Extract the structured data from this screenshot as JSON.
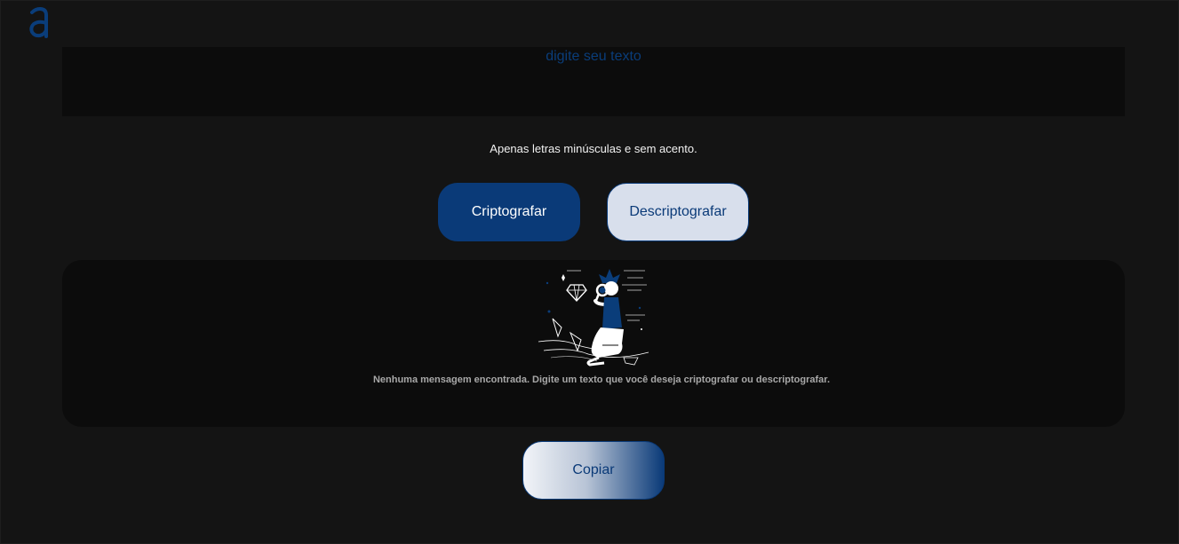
{
  "input": {
    "placeholder": "digite seu texto"
  },
  "hint": "Apenas letras minúsculas e sem acento.",
  "buttons": {
    "encrypt": "Criptografar",
    "decrypt": "Descriptografar",
    "copy": "Copiar"
  },
  "output": {
    "empty_message": "Nenhuma mensagem encontrada. Digite um texto que você deseja criptografar ou descriptografar.",
    "illustration_icon": "person-with-magnifier-diamond-illustration"
  },
  "logo_icon": "alura-logo-icon",
  "colors": {
    "accent": "#0a3a78",
    "background": "#141414",
    "panel": "#0c0c0c",
    "light_button": "#d8dfec"
  }
}
